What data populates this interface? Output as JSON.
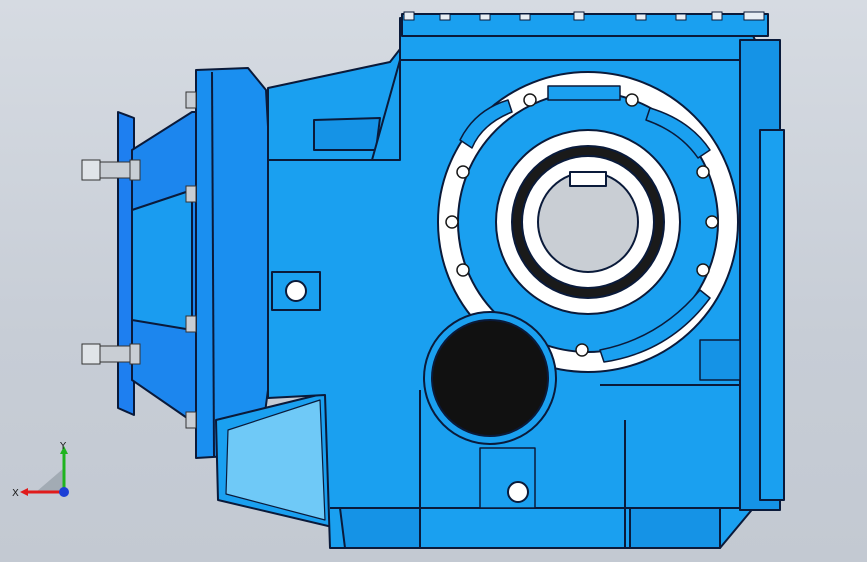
{
  "viewport": {
    "background_top": "#d6dbe2",
    "background_bottom": "#c3c9d2"
  },
  "model": {
    "name_icon": "gearbox-3d-model",
    "body_color": "#1aa0f0",
    "body_shadow": "#0e7fd8",
    "flange_color": "#1e7ff0",
    "edge_color": "#0a1a3a",
    "seal_color": "#ffffff",
    "bore_color": "#c9ced4"
  },
  "triad": {
    "x_label": "X",
    "y_label": "Y",
    "x_color": "#e01b1b",
    "y_color": "#1fb41f",
    "z_color": "#1c3fd6"
  }
}
